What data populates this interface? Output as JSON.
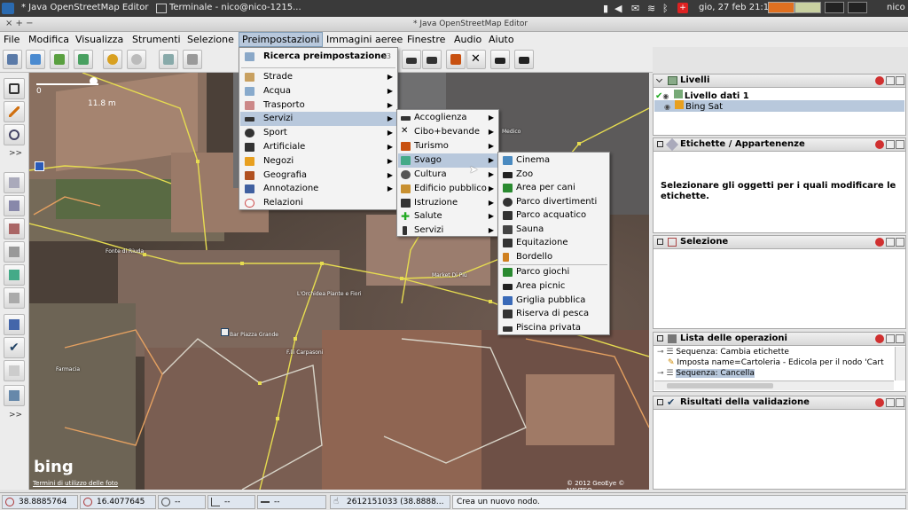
{
  "system_bar": {
    "window1": "* Java OpenStreetMap Editor",
    "window2": "Terminale - nico@nico-1215...",
    "datetime": "gio, 27 feb  21:15",
    "user": "nico"
  },
  "title_bar": {
    "left": "× + −",
    "title": "* Java OpenStreetMap Editor"
  },
  "menubar": {
    "items": [
      "File",
      "Modifica",
      "Visualizza",
      "Strumenti",
      "Selezione",
      "Preimpostazioni",
      "Immagini aeree",
      "Finestre",
      "Audio",
      "Aiuto"
    ]
  },
  "map": {
    "scale_start": "0",
    "scale_end": "11.8 m",
    "attribution_brand": "bing",
    "attribution_link": "Termini di utilizzo delle foto",
    "copyright": "© 2012 GeoEye © NAVTEQ",
    "labels": [
      "Medico",
      "Market Di Più",
      "L'Orchidea Piante e Fiori",
      "Bar Piazza Grande",
      "F.lli Carpasoni",
      "Farmacia",
      "Fonte di Riuda"
    ]
  },
  "preset_menu": {
    "search": "Ricerca preimpostazione",
    "shortcut": "F3",
    "items": [
      "Strade",
      "Acqua",
      "Trasporto",
      "Servizi",
      "Sport",
      "Artificiale",
      "Negozi",
      "Geografia",
      "Annotazione",
      "Relazioni"
    ],
    "highlighted": "Servizi"
  },
  "servizi_menu": {
    "items": [
      "Accoglienza",
      "Cibo+bevande",
      "Turismo",
      "Svago",
      "Cultura",
      "Edificio pubblico",
      "Istruzione",
      "Salute",
      "Servizi"
    ],
    "highlighted": "Svago"
  },
  "svago_menu": {
    "group1": [
      "Cinema",
      "Zoo",
      "Area per cani",
      "Parco divertimenti",
      "Parco acquatico",
      "Sauna",
      "Equitazione",
      "Bordello"
    ],
    "group2": [
      "Parco giochi",
      "Area picnic",
      "Griglia pubblica",
      "Riserva di pesca",
      "Piscina privata"
    ]
  },
  "panels": {
    "livelli": {
      "title": "Livelli",
      "layers": [
        "Livello dati 1",
        "Bing Sat"
      ]
    },
    "etichette": {
      "title": "Etichette / Appartenenze",
      "message": "Selezionare gli oggetti per i quali modificare le etichette."
    },
    "selezione": {
      "title": "Selezione"
    },
    "operazioni": {
      "title": "Lista delle operazioni",
      "entries": [
        "Sequenza: Cambia etichette",
        "Imposta name=Cartoleria - Edicola per il nodo 'Cart",
        "Sequenza: Cancella"
      ]
    },
    "validazione": {
      "title": "Risultati della validazione"
    }
  },
  "statusbar": {
    "lat": "38.8885764",
    "lon": "16.4077645",
    "heading": "--",
    "angle": "--",
    "distance": "--",
    "node": "2612151033 (38.8888...",
    "message": "Crea un nuovo nodo."
  }
}
